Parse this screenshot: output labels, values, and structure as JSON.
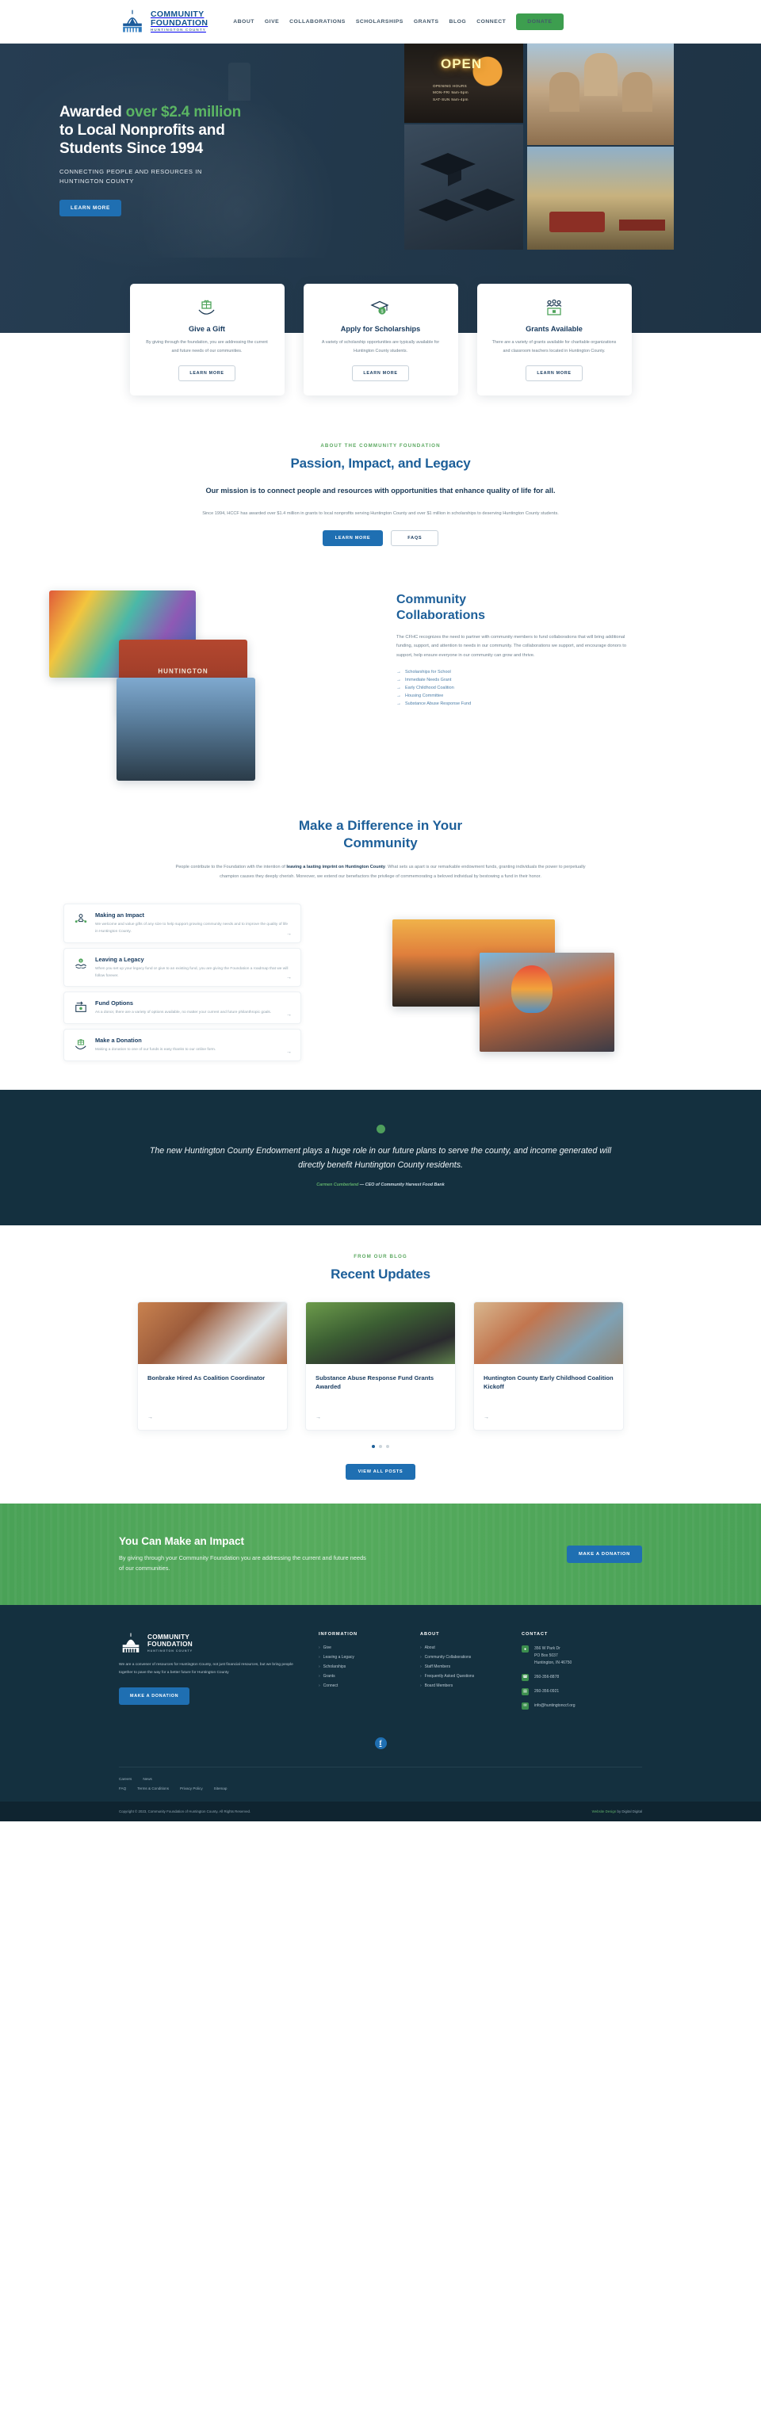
{
  "header": {
    "logo": {
      "line1": "COMMUNITY",
      "line2": "FOUNDATION",
      "line3": "HUNTINGTON COUNTY"
    },
    "nav": [
      {
        "label": "ABOUT"
      },
      {
        "label": "GIVE"
      },
      {
        "label": "COLLABORATIONS"
      },
      {
        "label": "SCHOLARSHIPS"
      },
      {
        "label": "GRANTS"
      },
      {
        "label": "BLOG"
      },
      {
        "label": "CONNECT"
      }
    ],
    "donate_label": "DONATE"
  },
  "hero": {
    "title_part1": "Awarded ",
    "title_highlight1": "over $2.4 million",
    "title_part2": " to Local Nonprofits and Students Since 1994",
    "subtitle": "CONNECTING PEOPLE AND RESOURCES IN HUNTINGTON COUNTY",
    "cta_label": "LEARN MORE",
    "collage": {
      "neon_text": "OPEN",
      "hours_line1": "OPENING HOURS",
      "hours_line2": "MON-FRI     9am-5pm",
      "hours_line3": "SAT-SUN     9am-4pm"
    }
  },
  "cards": [
    {
      "icon": "gift-hand-icon",
      "title": "Give a Gift",
      "text": "By giving through the foundation, you are addressing the current and future needs of our communities.",
      "cta": "LEARN MORE"
    },
    {
      "icon": "graduation-cap-icon",
      "title": "Apply for Scholarships",
      "text": "A variety of scholarship opportunities are typically available for Huntington County students.",
      "cta": "LEARN MORE"
    },
    {
      "icon": "group-money-icon",
      "title": "Grants Available",
      "text": "There are a variety of grants available for charitable organizations and classroom teachers located in Huntington County.",
      "cta": "LEARN MORE"
    }
  ],
  "about": {
    "eyebrow": "ABOUT THE COMMUNITY FOUNDATION",
    "title": "Passion, Impact, and Legacy",
    "mission": "Our mission is to connect people and resources with opportunities that enhance quality of life for all.",
    "body": "Since 1994, HCCF has awarded over $1.4 million in grants to local nonprofits serving Huntington County and over $1 million in scholarships to deserving Huntington County students.",
    "primary_cta": "LEARN MORE",
    "secondary_cta": "FAQS"
  },
  "collaborations": {
    "title_line1": "Community",
    "title_line2": "Collaborations",
    "body": "The CFHC recognizes the need to partner with community members to fund collaborations that will bring additional funding, support, and attention to needs in our community. The collaborations we support, and encourage donors to support, help ensure everyone in our community can grow and thrive.",
    "links": [
      {
        "label": "Scholarships for School"
      },
      {
        "label": "Immediate Needs Grant"
      },
      {
        "label": "Early Childhood Coalition"
      },
      {
        "label": "Housing Committee"
      },
      {
        "label": "Substance Abuse Response Fund"
      }
    ],
    "banner_text": "HUNTINGTON"
  },
  "difference": {
    "title": "Make a Difference in Your Community",
    "body_part1": "People contribute to the Foundation with the intention of ",
    "body_bold": "leaving a lasting imprint on Huntington County",
    "body_part2": ". What sets us apart is our remarkable endowment funds, granting individuals the power to perpetually champion causes they deeply cherish. Moreover, we extend our benefactors the privilege of commemorating a beloved individual by bestowing a fund in their honor.",
    "items": [
      {
        "icon": "people-network-icon",
        "title": "Making an Impact",
        "text": "We welcome and value gifts of any size to help support growing community needs and to improve the quality of life in Huntington County."
      },
      {
        "icon": "handshake-money-icon",
        "title": "Leaving a Legacy",
        "text": "When you set up your legacy fund or give to an existing fund, you are giving the Foundation a roadmap that we will follow forever."
      },
      {
        "icon": "fund-transfer-icon",
        "title": "Fund Options",
        "text": "As a donor, there are a variety of options available, no matter your current and future philanthropic goals."
      },
      {
        "icon": "gift-hand-icon",
        "title": "Make a Donation",
        "text": "Making a donation to one of our funds is easy thanks to our online form."
      }
    ]
  },
  "quote": {
    "text": "The new Huntington County Endowment plays a huge role in our future plans to serve the county, and income generated will directly benefit Huntington County residents.",
    "author": "Carmen Cumberland",
    "role": " — CEO of Community Harvest Food Bank"
  },
  "blog": {
    "eyebrow": "FROM OUR BLOG",
    "title": "Recent Updates",
    "posts": [
      {
        "title": "Bonbrake Hired As Coalition Coordinator"
      },
      {
        "title": "Substance Abuse Response Fund Grants Awarded"
      },
      {
        "title": "Huntington County Early Childhood Coalition Kickoff"
      }
    ],
    "dots": 3,
    "active_dot": 0,
    "cta": "VIEW ALL POSTS"
  },
  "impact": {
    "title": "You Can Make an Impact",
    "text": "By giving through your Community Foundation you are addressing the current and future needs of our communities.",
    "cta": "MAKE A DONATION"
  },
  "footer": {
    "logo": {
      "line1": "COMMUNITY",
      "line2": "FOUNDATION",
      "line3": "HUNTINGTON COUNTY"
    },
    "blurb": "We are a convener of resources for Huntington County, not just financial resources, but we bring people together to pave the way for a better future for Huntington County",
    "cta": "MAKE A DONATION",
    "columns": [
      {
        "heading": "INFORMATION",
        "links": [
          {
            "label": "Give"
          },
          {
            "label": "Leaving a Legacy"
          },
          {
            "label": "Scholarships"
          },
          {
            "label": "Grants"
          },
          {
            "label": "Connect"
          }
        ]
      },
      {
        "heading": "ABOUT",
        "links": [
          {
            "label": "About"
          },
          {
            "label": "Community Collaborations"
          },
          {
            "label": "Staff Members"
          },
          {
            "label": "Frequently Asked Questions"
          },
          {
            "label": "Board Members"
          }
        ]
      }
    ],
    "contact": {
      "heading": "CONTACT",
      "address": "356 W Park Dr\nPO Box 5037\nHuntington, IN 46750",
      "phone": "260-356-8878",
      "fax": "260-356-0921",
      "email": "info@huntingtonccf.org"
    },
    "social": {
      "facebook": "f"
    },
    "legal_row1": [
      {
        "label": "Careers"
      },
      {
        "label": "News"
      }
    ],
    "legal_row2": [
      {
        "label": "FAQ"
      },
      {
        "label": "Terms & Conditions"
      },
      {
        "label": "Privacy Policy"
      },
      {
        "label": "Sitemap"
      }
    ],
    "copyright": "Copyright © 2023, Community Foundation of Huntington County. All Rights Reserved.",
    "credit_prefix": "Website Design",
    "credit_by": " by Digital Digital"
  }
}
